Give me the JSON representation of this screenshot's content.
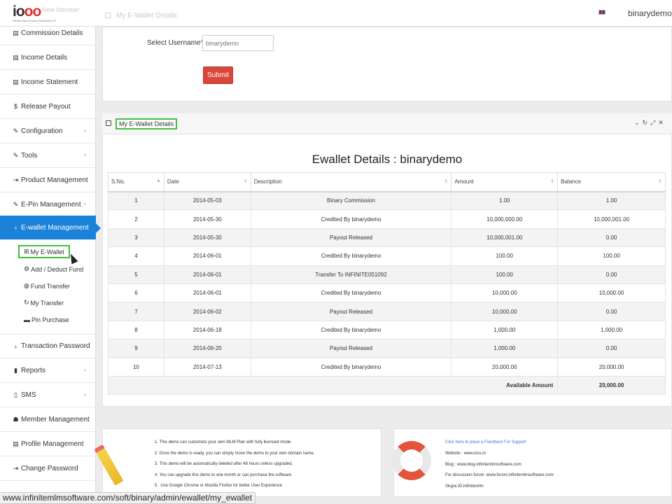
{
  "header": {
    "logo_text": "ioss",
    "logo_tagline": "Infinite Open Source Solutions LLP",
    "faint_nav": "New Member",
    "breadcrumb": "My E-Wallet Details",
    "user": "binarydemo"
  },
  "sidebar": {
    "items": [
      {
        "label": "Commission Details",
        "icon": "report-icon",
        "chevron": false
      },
      {
        "label": "Income Details",
        "icon": "document-icon",
        "chevron": false
      },
      {
        "label": "Income Statement",
        "icon": "report-icon",
        "chevron": false
      },
      {
        "label": "Release Payout",
        "icon": "dollar-icon",
        "chevron": false
      },
      {
        "label": "Configuration",
        "icon": "wrench-icon",
        "chevron": true
      },
      {
        "label": "Tools",
        "icon": "wrench-icon",
        "chevron": true
      },
      {
        "label": "Product Management",
        "icon": "sign-in-icon",
        "chevron": false
      },
      {
        "label": "E-Pin Management",
        "icon": "wrench-icon",
        "chevron": true
      },
      {
        "label": "E-wallet Management",
        "icon": "wallet-icon",
        "chevron": false,
        "active": true
      }
    ],
    "subitems": [
      {
        "label": "My E-Wallet",
        "icon": "cart-icon",
        "selected": true
      },
      {
        "label": "Add / Deduct Fund",
        "icon": "gear-icon"
      },
      {
        "label": "Fund Transfer",
        "icon": "globe-icon"
      },
      {
        "label": "My Transfer",
        "icon": "refresh-icon"
      },
      {
        "label": "Pin Purchase",
        "icon": "card-icon"
      }
    ],
    "items_after": [
      {
        "label": "Transaction Password",
        "icon": "lock-icon",
        "chevron": true
      },
      {
        "label": "Reports",
        "icon": "bar-chart-icon",
        "chevron": true
      },
      {
        "label": "SMS",
        "icon": "mobile-icon",
        "chevron": true
      },
      {
        "label": "Member Management",
        "icon": "users-icon",
        "chevron": true
      },
      {
        "label": "Profile Management",
        "icon": "card-icon",
        "chevron": false
      },
      {
        "label": "Change Password",
        "icon": "sign-in-icon",
        "chevron": false
      }
    ]
  },
  "form": {
    "username_label": "Select Username",
    "required_mark": "*",
    "username_value": "binarydemo",
    "submit_label": "Submit"
  },
  "ewallet": {
    "panel_title": "My E-Wallet Details",
    "heading": "Ewallet Details : binarydemo",
    "columns": [
      "S.No.",
      "Date",
      "Description",
      "Amount",
      "Balance"
    ],
    "rows": [
      [
        "1",
        "2014-05-03",
        "Binary Commission",
        "1.00",
        "1.00"
      ],
      [
        "2",
        "2014-05-30",
        "Credited By binarydemo",
        "10,000,000.00",
        "10,000,001.00"
      ],
      [
        "3",
        "2014-05-30",
        "Payout Released",
        "10,000,001.00",
        "0.00"
      ],
      [
        "4",
        "2014-06-01",
        "Credited By binarydemo",
        "100.00",
        "100.00"
      ],
      [
        "5",
        "2014-06-01",
        "Transfer To INFINITE051092",
        "100.00",
        "0.00"
      ],
      [
        "6",
        "2014-06-01",
        "Credited By binarydemo",
        "10,000.00",
        "10,000.00"
      ],
      [
        "7",
        "2014-06-02",
        "Payout Released",
        "10,000.00",
        "0.00"
      ],
      [
        "8",
        "2014-06-18",
        "Credited By binarydemo",
        "1,000.00",
        "1,000.00"
      ],
      [
        "9",
        "2014-06-20",
        "Payout Released",
        "1,000.00",
        "0.00"
      ],
      [
        "10",
        "2014-07-13",
        "Credited By binarydemo",
        "20,000.00",
        "20,000.00"
      ]
    ],
    "footer_label": "Available Amount",
    "footer_value": "20,000.00"
  },
  "notes": [
    "1. This demo can customize your own MLM Plan with fully licensed mode.",
    "2. Once the demo is ready, you can simply move the demo to your own domain name.",
    "3. This demo will be automatically deleted after 48 hours unless upgraded.",
    "4. You can upgrade this demo to one month or can purchase the software.",
    "5 . Use Google Chrome or Mozilla Firefox for better User Experience"
  ],
  "support": {
    "feedback_link": "Click here to place a Feedback For Support",
    "website": "Website : www.ioss.in",
    "blog": "Blog : www.blog.infinitemlmsoftware.com",
    "forum": "For discussion forum :www.forum.infinitemlmsoftware.com",
    "skype": "Skype ID:infinitemlm"
  },
  "statusbar_url": "www.infinitemlmsoftware.com/soft/binary/admin/ewallet/my_ewallet",
  "colors": {
    "accent": "#1b82d9",
    "submit": "#d9473b",
    "highlight": "#3fbf3f"
  }
}
